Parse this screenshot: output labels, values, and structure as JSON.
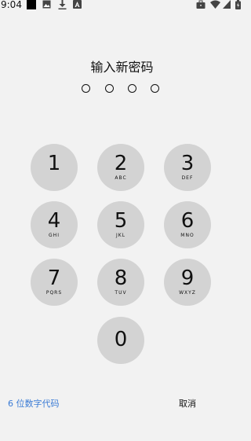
{
  "status_bar": {
    "time": "9:04",
    "icons": [
      "notification-square-icon",
      "image-icon",
      "download-icon",
      "a-badge-icon",
      "briefcase-icon",
      "wifi-icon",
      "signal-icon",
      "battery-icon"
    ]
  },
  "title": "输入新密码",
  "passcode": {
    "length": 4,
    "entered": 0
  },
  "keypad": [
    {
      "digit": "1",
      "letters": ""
    },
    {
      "digit": "2",
      "letters": "ABC"
    },
    {
      "digit": "3",
      "letters": "DEF"
    },
    {
      "digit": "4",
      "letters": "GHI"
    },
    {
      "digit": "5",
      "letters": "JKL"
    },
    {
      "digit": "6",
      "letters": "MNO"
    },
    {
      "digit": "7",
      "letters": "PQRS"
    },
    {
      "digit": "8",
      "letters": "TUV"
    },
    {
      "digit": "9",
      "letters": "WXYZ"
    },
    {
      "digit": "0",
      "letters": ""
    }
  ],
  "bottom": {
    "six_digit_label": "6 位数字代码",
    "cancel_label": "取消"
  },
  "colors": {
    "background": "#f2f2f2",
    "key": "#d3d3d3",
    "link": "#3a7bd5"
  }
}
